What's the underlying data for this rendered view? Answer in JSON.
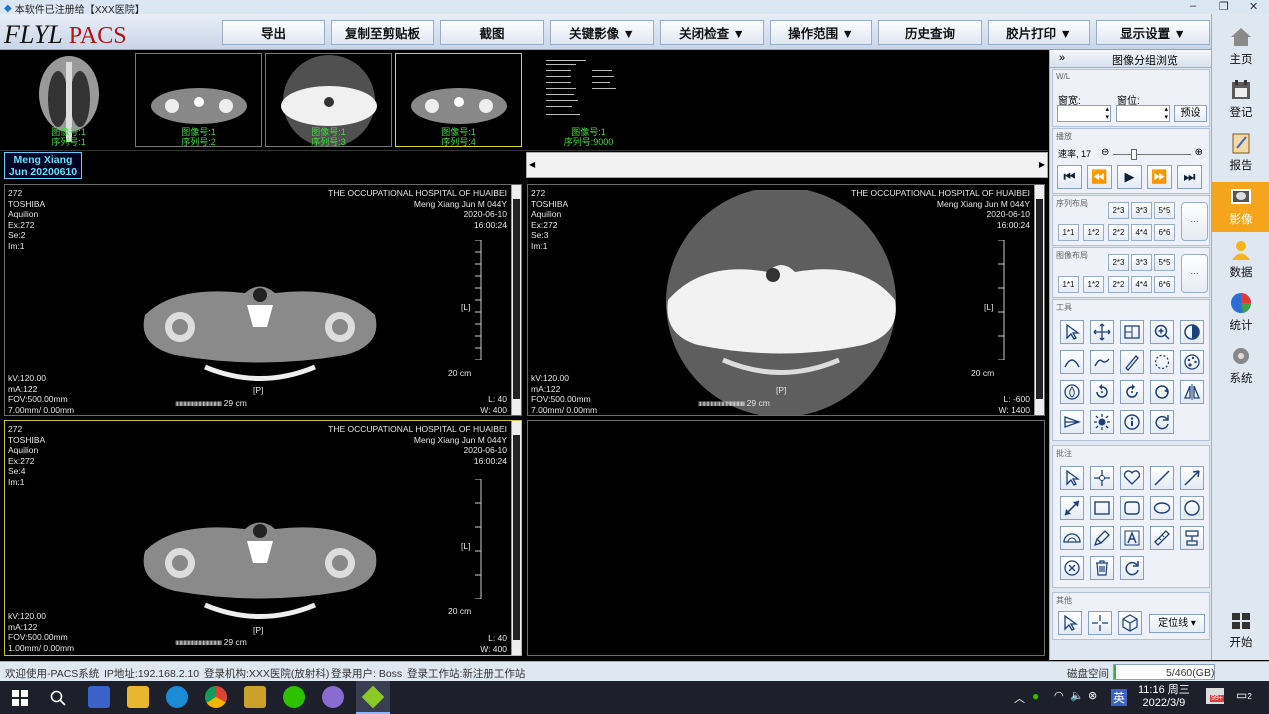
{
  "window": {
    "title": "本软件已注册给【XXX医院】"
  },
  "logo": {
    "brand": "FLYL",
    "product": "PACS"
  },
  "toolbar": [
    {
      "label": "导出"
    },
    {
      "label": "复制至剪贴板"
    },
    {
      "label": "截图"
    },
    {
      "label": "关键影像 ▼"
    },
    {
      "label": "关闭检查 ▼"
    },
    {
      "label": "操作范围 ▼"
    },
    {
      "label": "历史查询"
    },
    {
      "label": "胶片打印 ▼"
    },
    {
      "label": "显示设置 ▼"
    }
  ],
  "thumbnails": [
    {
      "img": "图像号:1",
      "ser": "序列号:1"
    },
    {
      "img": "图像号:1",
      "ser": "序列号:2"
    },
    {
      "img": "图像号:1",
      "ser": "序列号:3"
    },
    {
      "img": "图像号:1",
      "ser": "序列号:4"
    },
    {
      "img": "图像号:1",
      "ser": "序列号:9000"
    }
  ],
  "patient": {
    "name": "Meng Xiang",
    "date": "Jun 20200610"
  },
  "viewports": [
    {
      "id": "272",
      "maker": "TOSHIBA",
      "model": "Aquilion",
      "ex": "Ex:272",
      "se": "Se:2",
      "im": "Im:1",
      "hospital": "THE OCCUPATIONAL HOSPITAL OF HUAIBEI",
      "patient_line": "Meng Xiang Jun M  044Y",
      "date": "2020-06-10",
      "time": "16:00:24",
      "kv": "kV:120.00",
      "ma": "mA:122",
      "fov": "FOV:500.00mm",
      "thick": "7.00mm/ 0.00mm",
      "lev": "L: 40",
      "win": "W: 400",
      "scale_cm": "20 cm",
      "ruler": "29 cm",
      "orient_l": "[L]",
      "orient_p": "[P]"
    },
    {
      "id": "272",
      "maker": "TOSHIBA",
      "model": "Aquilion",
      "ex": "Ex:272",
      "se": "Se:3",
      "im": "Im:1",
      "hospital": "THE OCCUPATIONAL HOSPITAL OF HUAIBEI",
      "patient_line": "Meng Xiang Jun M  044Y",
      "date": "2020-06-10",
      "time": "16:00:24",
      "kv": "kV:120.00",
      "ma": "mA:122",
      "fov": "FOV:500.00mm",
      "thick": "7.00mm/ 0.00mm",
      "lev": "L: -600",
      "win": "W: 1400",
      "scale_cm": "20 cm",
      "ruler": "29 cm",
      "orient_l": "[L]",
      "orient_p": "[P]"
    },
    {
      "id": "272",
      "maker": "TOSHIBA",
      "model": "Aquilion",
      "ex": "Ex:272",
      "se": "Se:4",
      "im": "Im:1",
      "hospital": "THE OCCUPATIONAL HOSPITAL OF HUAIBEI",
      "patient_line": "Meng Xiang Jun M  044Y",
      "date": "2020-06-10",
      "time": "16:00:24",
      "kv": "kV:120.00",
      "ma": "mA:122",
      "fov": "FOV:500.00mm",
      "thick": "1.00mm/ 0.00mm",
      "lev": "L: 40",
      "win": "W: 400",
      "scale_cm": "20 cm",
      "ruler": "29 cm",
      "orient_l": "[L]",
      "orient_p": "[P]"
    }
  ],
  "right_panel": {
    "header": "图像分组浏览",
    "collapse": "»",
    "wl_title": "W/L",
    "win_width_label": "窗宽:",
    "win_level_label": "窗位:",
    "preset": "预设",
    "play_title": "播放",
    "speed_label": "速率, 17",
    "series_layout_title": "序列布局",
    "image_layout_title": "图像布局",
    "layout_row1": [
      "2*3",
      "3*3",
      "5*5"
    ],
    "layout_row2": [
      "1*1",
      "1*2",
      "2*2",
      "4*4",
      "6*6"
    ],
    "more": "···",
    "tools_title": "工具",
    "annot_title": "批注",
    "other_title": "其他",
    "locator": "定位线 ▾"
  },
  "sidebar": [
    {
      "label": "主页",
      "icon": "home-icon"
    },
    {
      "label": "登记",
      "icon": "register-icon"
    },
    {
      "label": "报告",
      "icon": "report-icon"
    },
    {
      "label": "影像",
      "icon": "image-icon"
    },
    {
      "label": "数据",
      "icon": "data-icon"
    },
    {
      "label": "统计",
      "icon": "pie-chart-icon"
    },
    {
      "label": "系统",
      "icon": "gear-icon"
    },
    {
      "label": "开始",
      "icon": "windows-icon"
    }
  ],
  "status": {
    "welcome": "欢迎使用-PACS系统",
    "ip": "IP地址:192.168.2.10",
    "org": "登录机构:XXX医院(放射科)",
    "user": "登录用户: Boss",
    "station": "登录工作站:新注册工作站",
    "disk_label": "磁盘空间",
    "disk_value": "5/460(GB)",
    "disk_used_fraction": 0.011
  },
  "taskbar": {
    "time": "11:16 周三",
    "date": "2022/3/9",
    "ime": "英",
    "badge": "99+",
    "notif": "2"
  },
  "colors": {
    "accent": "#f4a51c",
    "overlay_green": "#3bdc3b",
    "active_border": "#c9c43a"
  }
}
